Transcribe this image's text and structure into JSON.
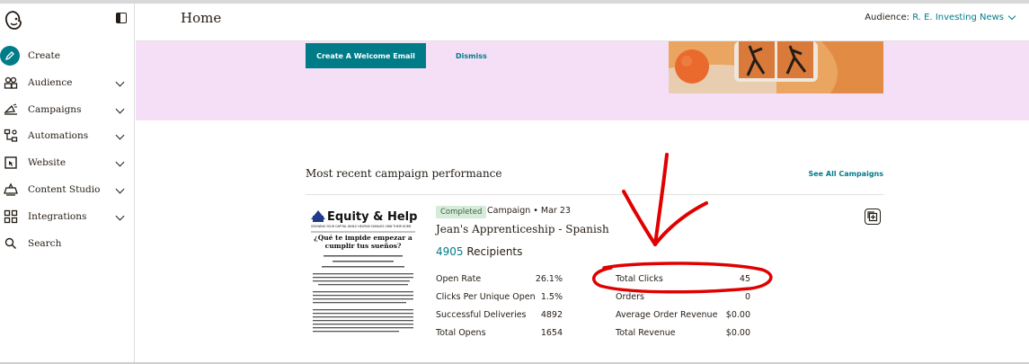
{
  "sidebar": {
    "items": [
      {
        "label": "Create",
        "icon": "pencil-icon"
      },
      {
        "label": "Audience",
        "icon": "audience-icon"
      },
      {
        "label": "Campaigns",
        "icon": "megaphone-icon"
      },
      {
        "label": "Automations",
        "icon": "automations-icon"
      },
      {
        "label": "Website",
        "icon": "website-icon"
      },
      {
        "label": "Content Studio",
        "icon": "content-studio-icon"
      },
      {
        "label": "Integrations",
        "icon": "integrations-icon"
      },
      {
        "label": "Search",
        "icon": "search-icon"
      }
    ]
  },
  "header": {
    "title": "Home",
    "audience_label": "Audience:",
    "audience_name": "R. E. Investing News"
  },
  "banner": {
    "primary_button": "Create A Welcome Email",
    "dismiss": "Dismiss"
  },
  "performance": {
    "title": "Most recent campaign performance",
    "see_all": "See All Campaigns",
    "status": "Completed",
    "meta": "Campaign • Mar 23",
    "campaign_name": "Jean's Apprenticeship - Spanish",
    "recipients_count": "4905",
    "recipients_label": "Recipients",
    "stats_left": [
      {
        "label": "Open Rate",
        "value": "26.1%"
      },
      {
        "label": "Clicks Per Unique Open",
        "value": "1.5%"
      },
      {
        "label": "Successful Deliveries",
        "value": "4892"
      },
      {
        "label": "Total Opens",
        "value": "1654"
      }
    ],
    "stats_right": [
      {
        "label": "Total Clicks",
        "value": "45"
      },
      {
        "label": "Orders",
        "value": "0"
      },
      {
        "label": "Average Order Revenue",
        "value": "$0.00"
      },
      {
        "label": "Total Revenue",
        "value": "$0.00"
      }
    ]
  },
  "thumbnail": {
    "brand": "Equity & Help",
    "tagline": "GROWING YOUR CAPITAL WHILE HELPING FAMILIES OWN THEIR HOME",
    "headline": "¿Qué te impide empezar a cumplir tus sueños?"
  },
  "colors": {
    "accent": "#007c89",
    "banner_bg": "#f5dff7",
    "annotation": "#e00000"
  }
}
